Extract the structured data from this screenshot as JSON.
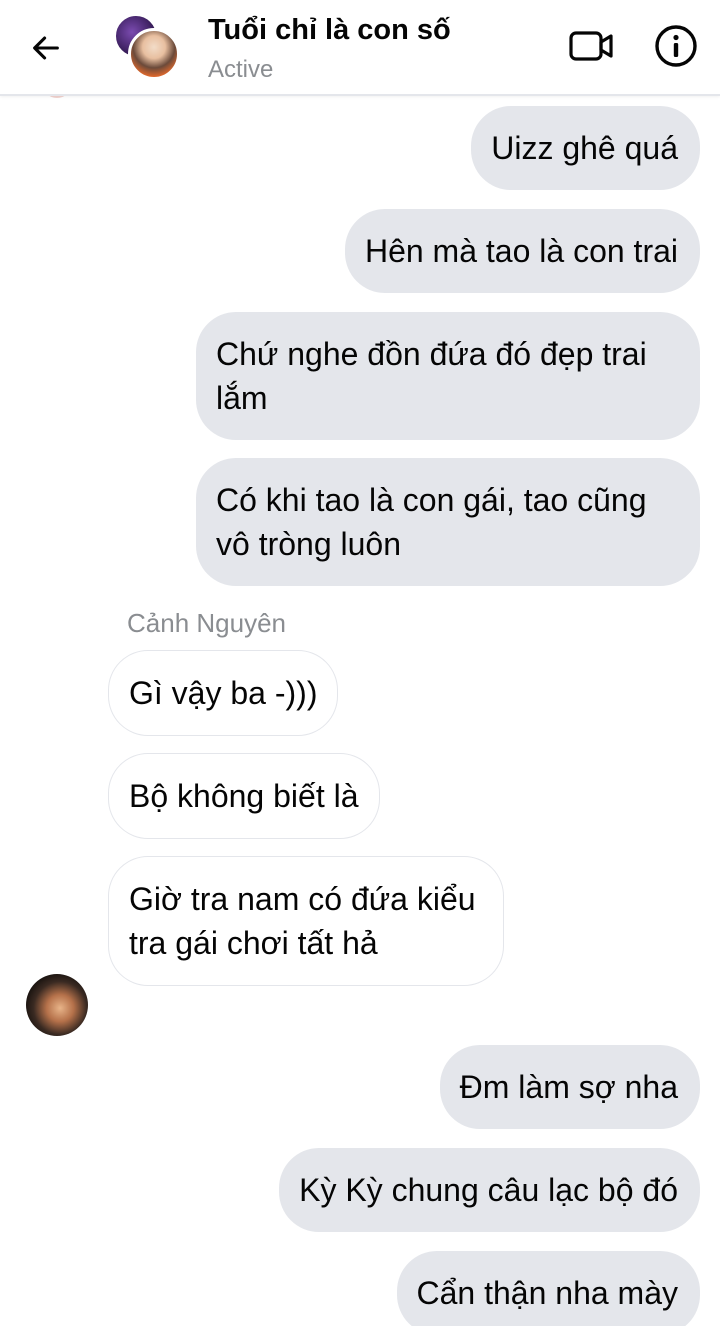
{
  "header": {
    "title": "Tuổi chỉ là con số",
    "status": "Active",
    "icons": {
      "back": "arrow-left-icon",
      "video": "video-camera-icon",
      "info": "info-icon"
    }
  },
  "conversation": {
    "outgoing_top": [
      "Uizz ghê quá",
      "Hên mà tao là con trai",
      "Chứ nghe đồn đứa đó đẹp trai lắm",
      "Có khi tao là con gái, tao cũng vô tròng luôn"
    ],
    "sender_name": "Cảnh Nguyên",
    "incoming": [
      "Gì vậy ba -)))",
      "Bộ không biết là",
      "Giờ tra nam có đứa kiểu tra gái chơi tất hả"
    ],
    "outgoing_bottom": [
      "Đm làm sợ nha",
      "Kỳ Kỳ chung câu lạc bộ đó",
      "Cẩn thận nha mày"
    ]
  },
  "colors": {
    "outgoing_bubble": "#e4e6eb",
    "incoming_bubble_border": "#e4e6eb",
    "text": "#050505",
    "secondary_text": "#8a8d91",
    "background": "#ffffff"
  }
}
